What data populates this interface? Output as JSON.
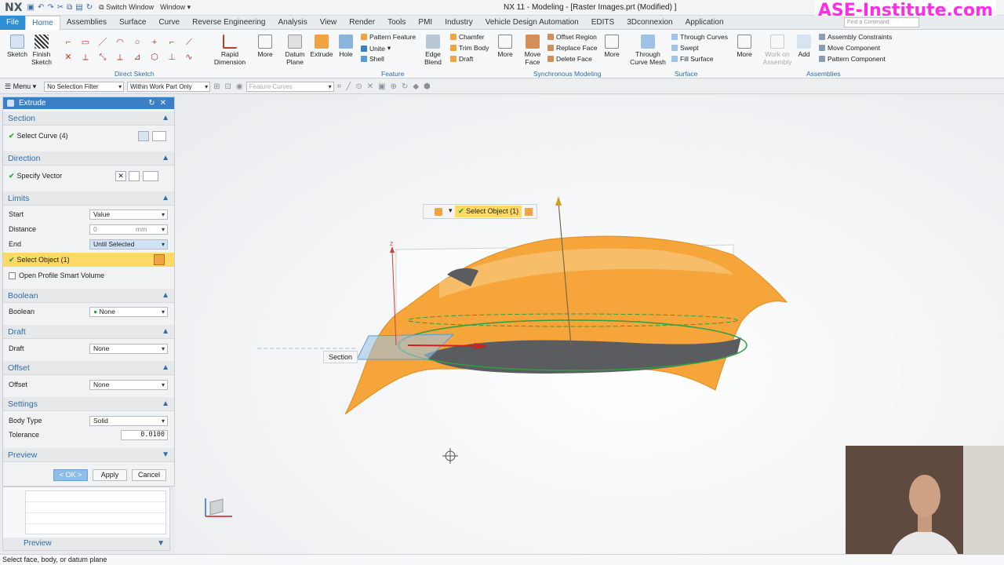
{
  "app": {
    "logo": "NX",
    "window_title": "NX 11 - Modeling - [Raster Images.prt (Modified) ]",
    "switch_window": "Switch Window",
    "window_menu": "Window",
    "watermark": "ASE-Institute.com",
    "find_command_placeholder": "Find a Command"
  },
  "menubar": {
    "tabs": [
      "File",
      "Home",
      "Assemblies",
      "Surface",
      "Curve",
      "Reverse Engineering",
      "Analysis",
      "View",
      "Render",
      "Tools",
      "PMI",
      "Industry",
      "Vehicle Design Automation",
      "EDITS",
      "3Dconnexion",
      "Application"
    ],
    "active": "Home"
  },
  "ribbon": {
    "sketch": "Sketch",
    "finish_sketch": "Finish Sketch",
    "rapid_dimension": "Rapid Dimension",
    "more": "More",
    "datum_plane": "Datum Plane",
    "extrude": "Extrude",
    "hole": "Hole",
    "pattern_feature": "Pattern Feature",
    "unite": "Unite",
    "shell": "Shell",
    "edge_blend": "Edge Blend",
    "chamfer": "Chamfer",
    "trim_body": "Trim Body",
    "draft": "Draft",
    "move_face": "Move Face",
    "offset_region": "Offset Region",
    "replace_face": "Replace Face",
    "delete_face": "Delete Face",
    "through_curve_mesh": "Through Curve Mesh",
    "through_curves": "Through Curves",
    "swept": "Swept",
    "fill_surface": "Fill Surface",
    "work_on_assembly": "Work on Assembly",
    "add": "Add",
    "assembly_constraints": "Assembly Constraints",
    "move_component": "Move Component",
    "pattern_component": "Pattern Component",
    "groups": {
      "direct_sketch": "Direct Sketch",
      "feature": "Feature",
      "synchronous_modeling": "Synchronous Modeling",
      "surface": "Surface",
      "assemblies": "Assemblies"
    }
  },
  "selection_bar": {
    "menu": "Menu",
    "filter": "No Selection Filter",
    "scope": "Within Work Part Only",
    "curve_rule": "Feature Curves"
  },
  "dialog": {
    "title": "Extrude",
    "section": {
      "header": "Section",
      "select_curve": "Select Curve (4)"
    },
    "direction": {
      "header": "Direction",
      "specify_vector": "Specify Vector"
    },
    "limits": {
      "header": "Limits",
      "start_label": "Start",
      "start_value": "Value",
      "distance_label": "Distance",
      "distance_value": "0",
      "distance_unit": "mm",
      "end_label": "End",
      "end_value": "Until Selected",
      "select_object": "Select Object (1)",
      "open_profile": "Open Profile Smart Volume"
    },
    "boolean": {
      "header": "Boolean",
      "label": "Boolean",
      "value": "None"
    },
    "draft": {
      "header": "Draft",
      "label": "Draft",
      "value": "None"
    },
    "offset": {
      "header": "Offset",
      "label": "Offset",
      "value": "None"
    },
    "settings": {
      "header": "Settings",
      "body_type_label": "Body Type",
      "body_type_value": "Solid",
      "tolerance_label": "Tolerance",
      "tolerance_value": "0.0100"
    },
    "preview": {
      "header": "Preview"
    },
    "buttons": {
      "ok": "< OK >",
      "apply": "Apply",
      "cancel": "Cancel"
    }
  },
  "lower_panel": {
    "preview_label": "Preview"
  },
  "viewport": {
    "popup_select_object": "Select Object (1)",
    "section_label": "Section",
    "axis_z": "Z"
  },
  "statusbar": {
    "text": "Select face, body, or datum plane"
  },
  "colors": {
    "accent": "#2e8fd6",
    "dialog_header": "#3b7fc4",
    "highlight": "#ffd966",
    "surface": "#f6a53a",
    "curve": "#2f9e44",
    "watermark": "#ff2ee6"
  }
}
